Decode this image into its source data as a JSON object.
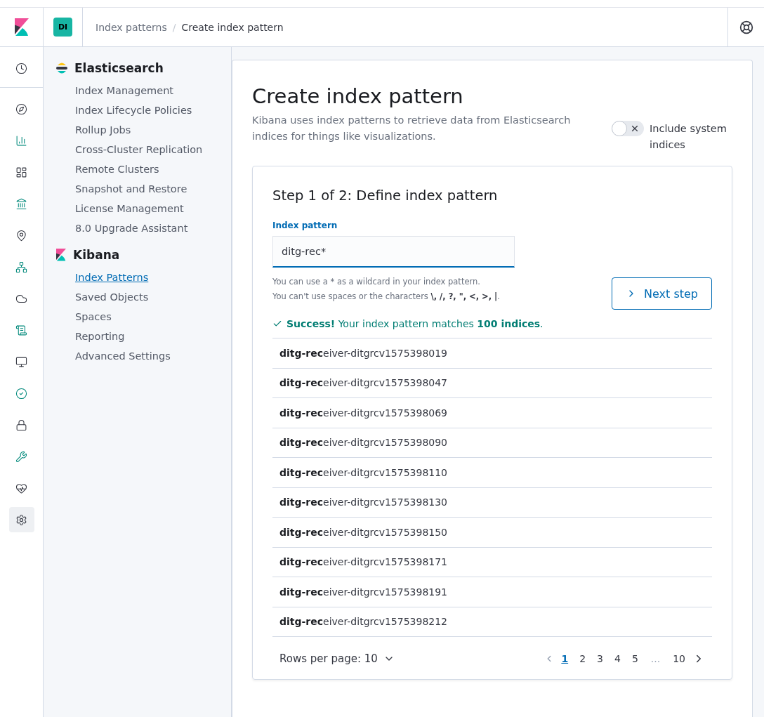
{
  "header": {
    "space_badge": "DI",
    "breadcrumbs": [
      "Index patterns",
      "Create index pattern"
    ],
    "breadcrumb_separator": "/"
  },
  "nav_rail": [
    {
      "selected": false
    },
    {
      "selected": false
    },
    {
      "selected": false
    },
    {
      "selected": false
    },
    {
      "selected": false
    },
    {
      "selected": false
    },
    {
      "selected": false
    },
    {
      "selected": false
    },
    {
      "selected": false
    },
    {
      "selected": false
    },
    {
      "selected": false
    },
    {
      "selected": false
    },
    {
      "selected": false
    },
    {
      "selected": false
    },
    {
      "selected": true
    }
  ],
  "sidebar": {
    "sections": [
      {
        "title": "Elasticsearch",
        "kind": "elasticsearch",
        "items": [
          {
            "label": "Index Management",
            "selected": false
          },
          {
            "label": "Index Lifecycle Policies",
            "selected": false
          },
          {
            "label": "Rollup Jobs",
            "selected": false
          },
          {
            "label": "Cross-Cluster Replication",
            "selected": false
          },
          {
            "label": "Remote Clusters",
            "selected": false
          },
          {
            "label": "Snapshot and Restore",
            "selected": false
          },
          {
            "label": "License Management",
            "selected": false
          },
          {
            "label": "8.0 Upgrade Assistant",
            "selected": false
          }
        ]
      },
      {
        "title": "Kibana",
        "kind": "kibana",
        "items": [
          {
            "label": "Index Patterns",
            "selected": true
          },
          {
            "label": "Saved Objects",
            "selected": false
          },
          {
            "label": "Spaces",
            "selected": false
          },
          {
            "label": "Reporting",
            "selected": false
          },
          {
            "label": "Advanced Settings",
            "selected": false
          }
        ]
      }
    ]
  },
  "page": {
    "title": "Create index pattern",
    "description": "Kibana uses index patterns to retrieve data from Elasticsearch indices for things like visualizations.",
    "system_indices_toggle": {
      "label": "Include system indices",
      "on": false
    },
    "step": {
      "title": "Step 1 of 2: Define index pattern",
      "field_label": "Index pattern",
      "value": "ditg-rec*",
      "hints": [
        "You can use a * as a wildcard in your index pattern.",
        "You can't use spaces or the characters **\\, /, ?, \", <, >, |**."
      ],
      "next_button": "Next step",
      "success": "**Success!** Your index pattern matches **100 indices**.",
      "rows": [
        "**ditg-rec**eiver-ditgrcv1575398019",
        "**ditg-rec**eiver-ditgrcv1575398047",
        "**ditg-rec**eiver-ditgrcv1575398069",
        "**ditg-rec**eiver-ditgrcv1575398090",
        "**ditg-rec**eiver-ditgrcv1575398110",
        "**ditg-rec**eiver-ditgrcv1575398130",
        "**ditg-rec**eiver-ditgrcv1575398150",
        "**ditg-rec**eiver-ditgrcv1575398171",
        "**ditg-rec**eiver-ditgrcv1575398191",
        "**ditg-rec**eiver-ditgrcv1575398212"
      ],
      "rows_per_page": "Rows per page: 10",
      "pages": [
        {
          "label": "1",
          "kind": "page",
          "selected": true
        },
        {
          "label": "2",
          "kind": "page",
          "selected": false
        },
        {
          "label": "3",
          "kind": "page",
          "selected": false
        },
        {
          "label": "4",
          "kind": "page",
          "selected": false
        },
        {
          "label": "5",
          "kind": "page",
          "selected": false
        },
        {
          "label": "...",
          "kind": "ellipsis"
        },
        {
          "label": "10",
          "kind": "page",
          "selected": false
        }
      ]
    }
  }
}
